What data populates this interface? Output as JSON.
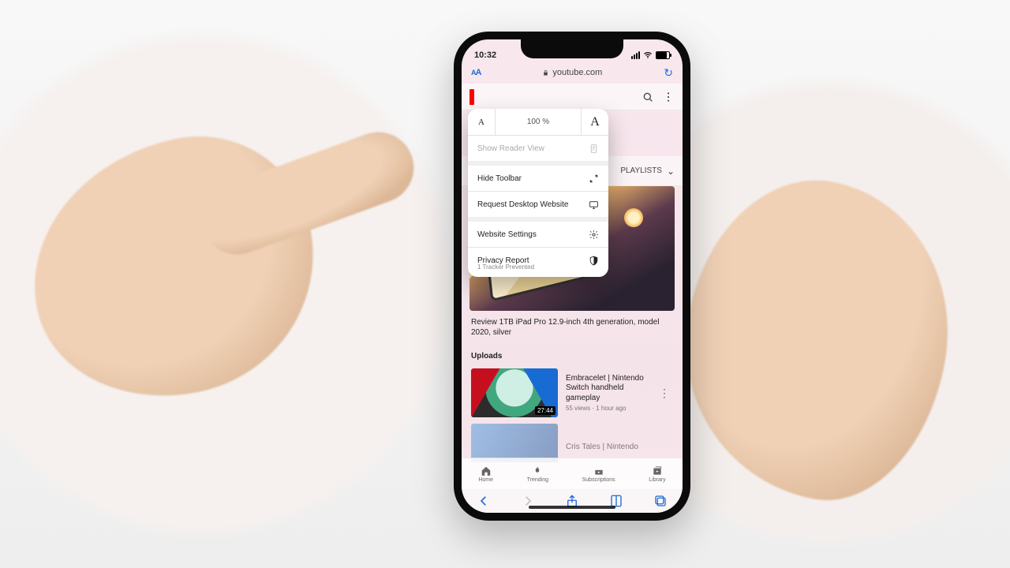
{
  "status": {
    "time": "10:32"
  },
  "url": {
    "domain": "youtube.com"
  },
  "aa_menu": {
    "zoom": "100 %",
    "reader": "Show Reader View",
    "hide_toolbar": "Hide Toolbar",
    "desktop": "Request Desktop Website",
    "settings": "Website Settings",
    "privacy": "Privacy Report",
    "privacy_sub": "1 Tracker Prevented"
  },
  "tabrow": {
    "playlists": "PLAYLISTS"
  },
  "hero": {
    "title": "Review 1TB iPad Pro 12.9-inch 4th generation, model 2020, silver"
  },
  "uploads": {
    "heading": "Uploads",
    "items": [
      {
        "duration": "27:44",
        "title": "Embracelet | Nintendo Switch handheld gameplay",
        "stats": "55 views · 1 hour ago"
      },
      {
        "title": "Cris Tales | Nintendo"
      }
    ]
  },
  "yt_tabs": {
    "home": "Home",
    "trending": "Trending",
    "subs": "Subscriptions",
    "library": "Library"
  }
}
